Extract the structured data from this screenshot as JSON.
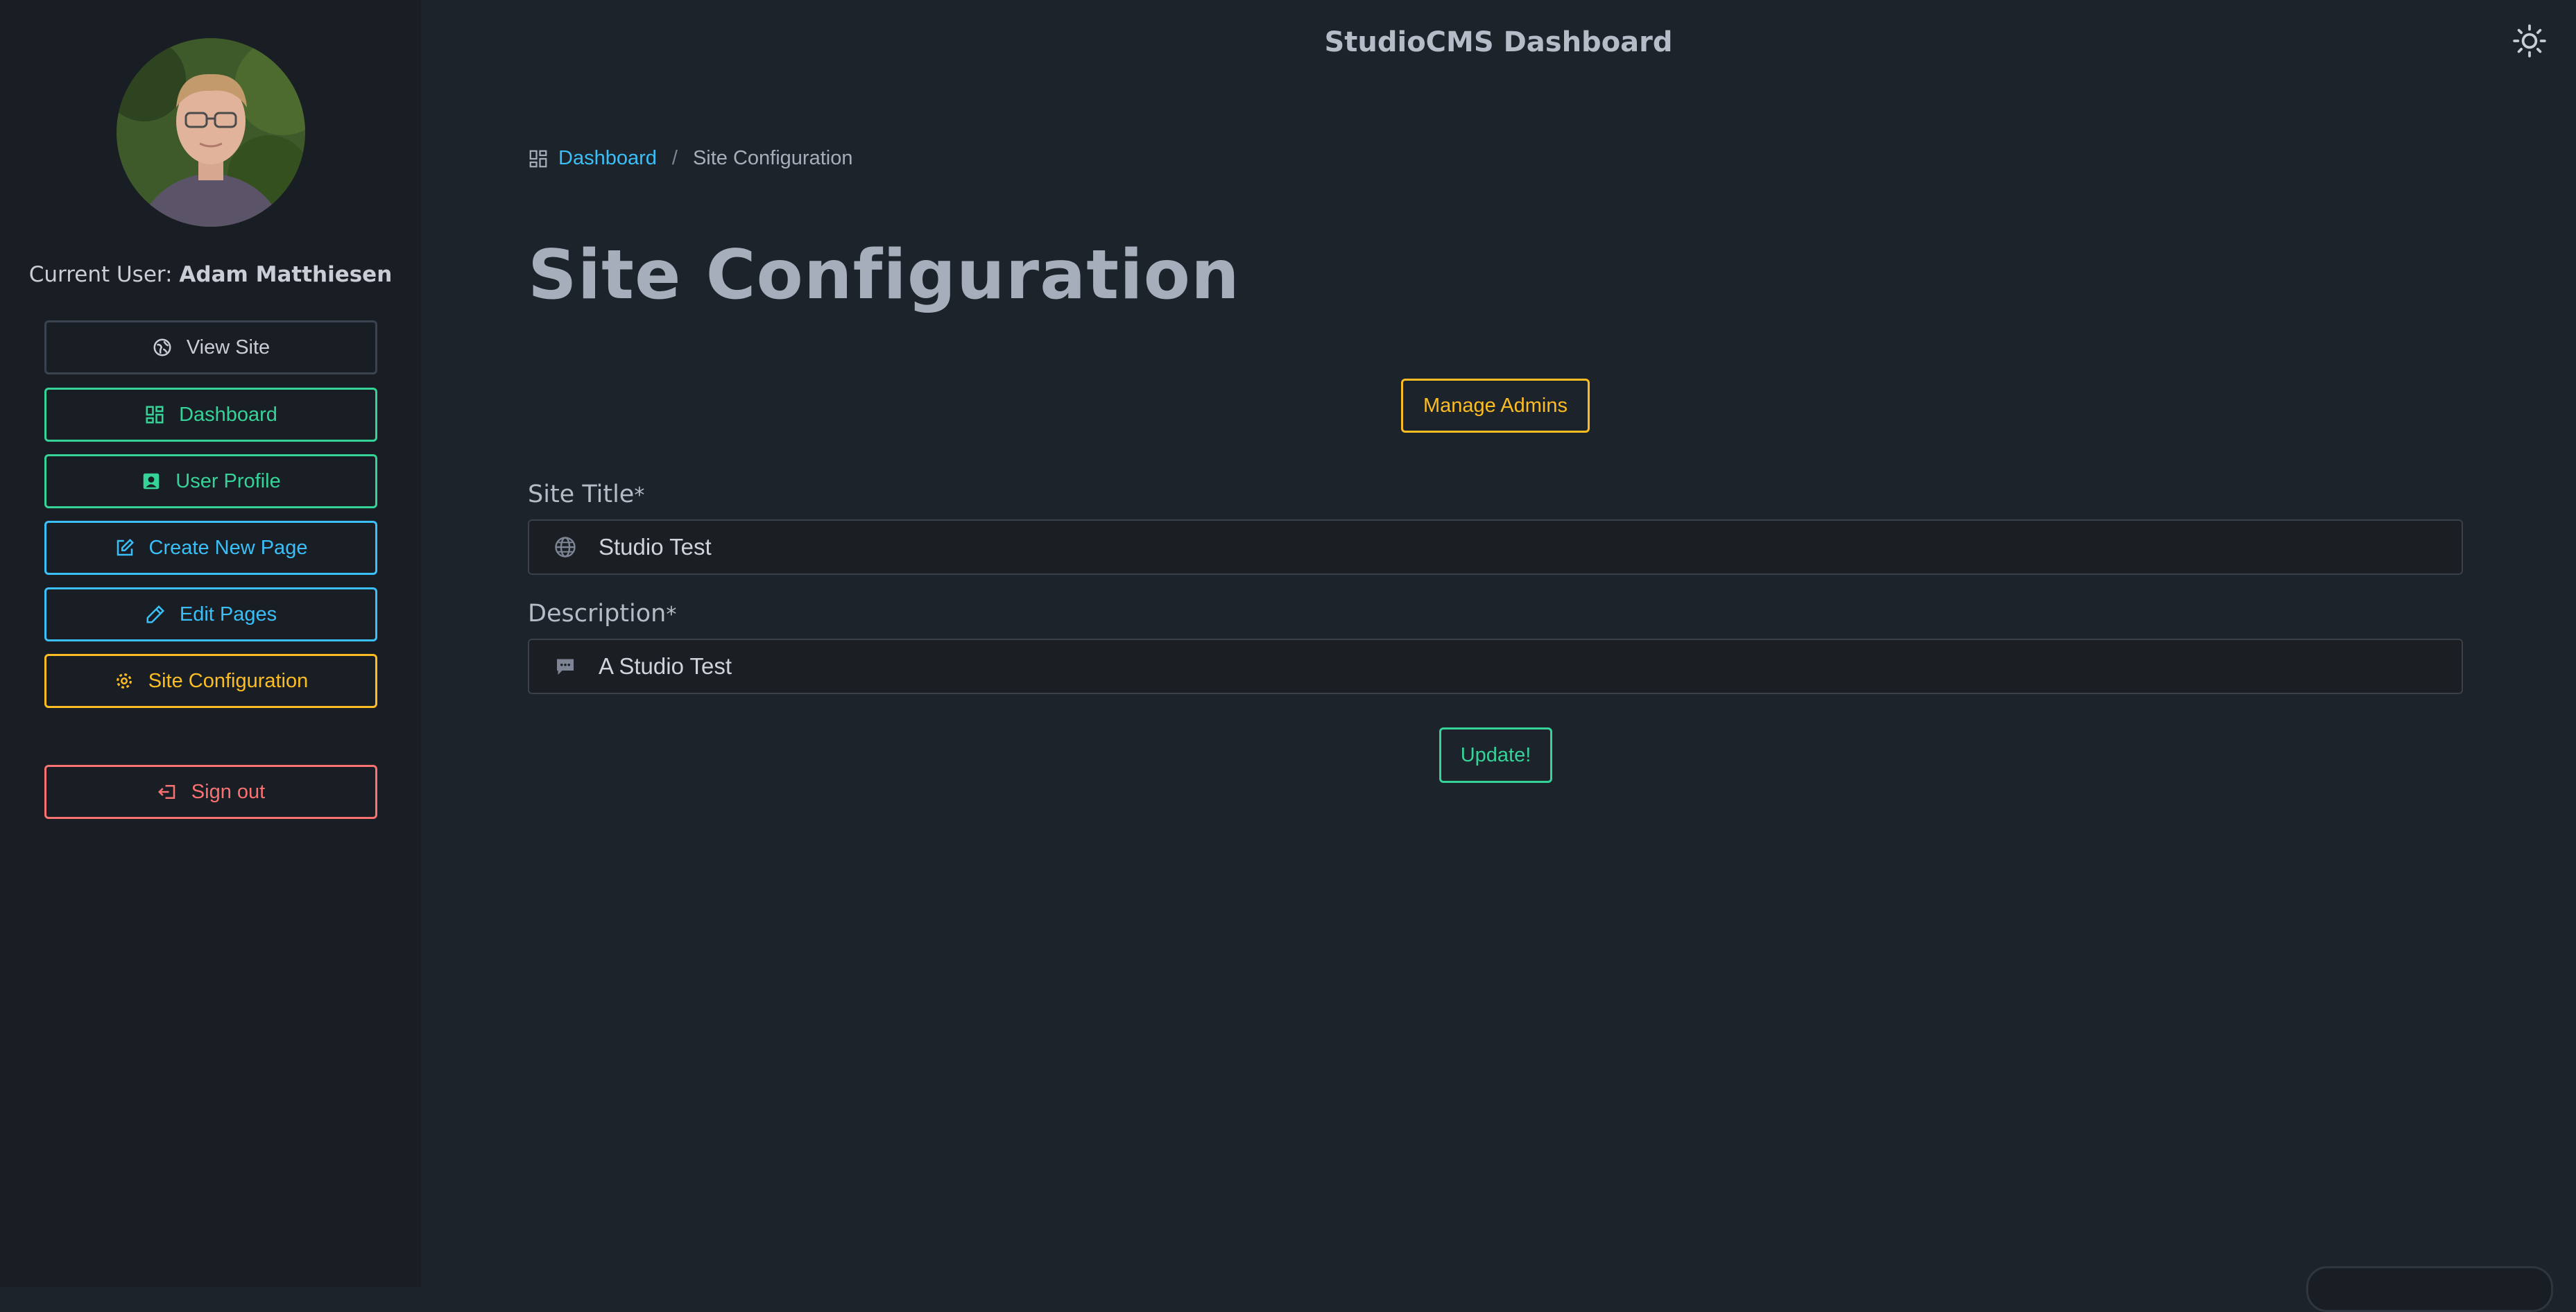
{
  "header": {
    "title": "StudioCMS Dashboard",
    "theme_toggle_icon": "sun-icon"
  },
  "sidebar": {
    "current_user_prefix": "Current User:",
    "current_user_name": "Adam Matthiesen",
    "items": [
      {
        "label": "View Site",
        "icon": "globe-icon",
        "color": "#c9ced6"
      },
      {
        "label": "Dashboard",
        "icon": "dashboard-icon",
        "color": "#36d399"
      },
      {
        "label": "User Profile",
        "icon": "user-card-icon",
        "color": "#36d399"
      },
      {
        "label": "Create New Page",
        "icon": "edit-square-icon",
        "color": "#3abff8"
      },
      {
        "label": "Edit Pages",
        "icon": "pencil-icon",
        "color": "#3abff8"
      },
      {
        "label": "Site Configuration",
        "icon": "gear-icon",
        "color": "#fbbd23"
      }
    ],
    "sign_out": {
      "label": "Sign out",
      "icon": "sign-out-icon",
      "color": "#f87272"
    }
  },
  "breadcrumb": {
    "icon": "dashboard-icon",
    "home": "Dashboard",
    "separator": "/",
    "current": "Site Configuration"
  },
  "main": {
    "title": "Site Configuration",
    "manage_admins_label": "Manage Admins",
    "fields": [
      {
        "label": "Site Title",
        "required_mark": "*",
        "icon": "globe-icon",
        "value": "Studio Test"
      },
      {
        "label": "Description",
        "required_mark": "*",
        "icon": "chat-bubble-icon",
        "value": "A Studio Test"
      }
    ],
    "update_label": "Update!"
  },
  "colors": {
    "background": "#1d232a",
    "sidebar": "#191e24",
    "success": "#36d399",
    "info": "#3abff8",
    "warning": "#fbbd23",
    "error": "#f87272"
  }
}
